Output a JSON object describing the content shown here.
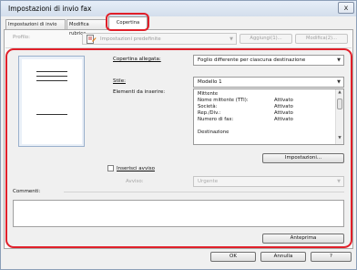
{
  "window": {
    "title": "Impostazioni di invio fax",
    "close_glyph": "x"
  },
  "tabs": [
    {
      "label": "Impostazioni di invio"
    },
    {
      "label": "Modifica rubrica"
    },
    {
      "label": "Copertina",
      "selected": true
    }
  ],
  "profile": {
    "label": "Profilo:",
    "value": "Impostazioni predefinite",
    "add_button": "Aggiungi(1)...",
    "edit_button": "Modifica(2)..."
  },
  "cover": {
    "attached_label": "Copertina allegata:",
    "attached_value": "Foglio differente per ciascuna destinazione",
    "style_label": "Stile:",
    "style_value": "Modello 1",
    "items_label": "Elementi da inserire:",
    "items": [
      {
        "name": "Mittente",
        "value": ""
      },
      {
        "name": "Nome mittente (TTI):",
        "value": "Attivato"
      },
      {
        "name": "Società:",
        "value": "Attivato"
      },
      {
        "name": "Rep./Div.:",
        "value": "Attivato"
      },
      {
        "name": "Numero di fax:",
        "value": "Attivato"
      },
      {
        "name": "",
        "value": ""
      },
      {
        "name": "Destinazione",
        "value": ""
      }
    ],
    "settings_button": "Impostazioni...",
    "notice_checkbox_label": "Inserisci avviso",
    "notice_checked": false,
    "notice_field_label": "Avviso:",
    "notice_value": "Urgente",
    "comments_label": "Commenti:",
    "comments_value": "",
    "preview_button": "Anteprima"
  },
  "footer": {
    "ok": "OK",
    "cancel": "Annulla",
    "help": "?"
  },
  "colors": {
    "highlight_red": "#e0202a",
    "panel_bg": "#f0f0f0",
    "title_bar": "#dbe5f1"
  }
}
